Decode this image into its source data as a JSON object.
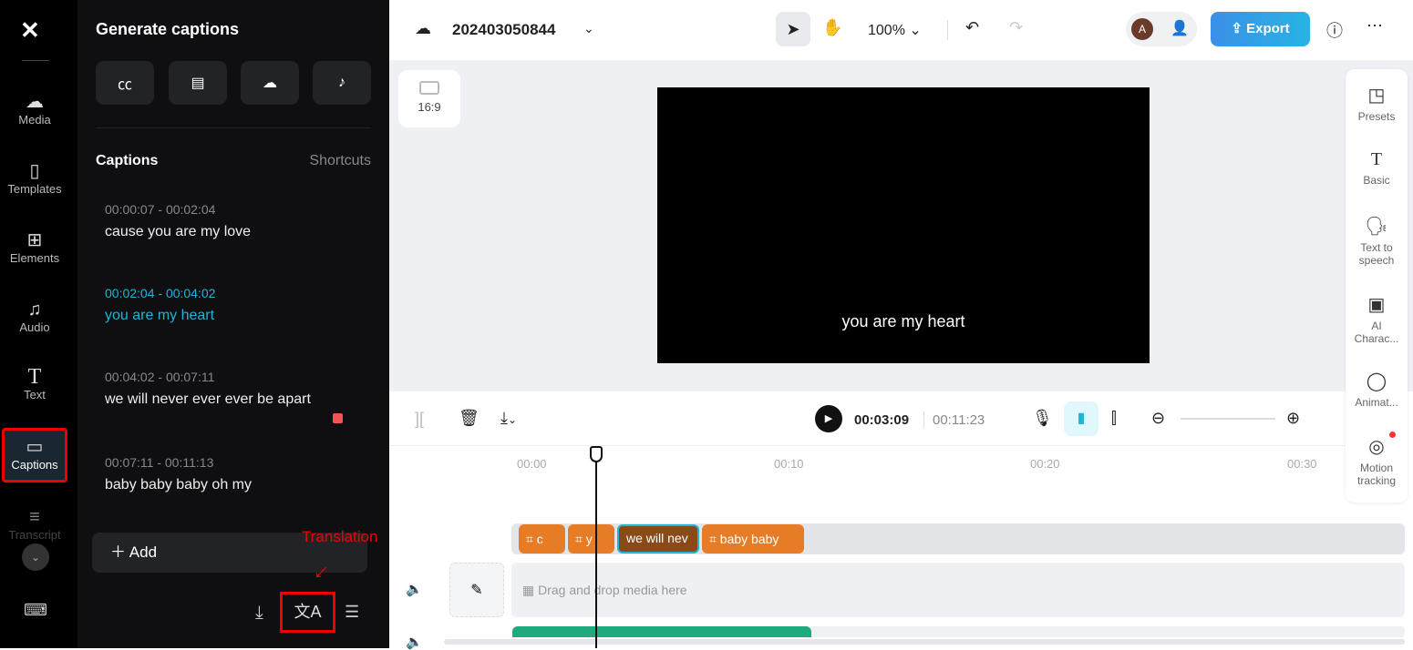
{
  "rail": {
    "items": [
      {
        "label": "Media",
        "icon": "cloud-upload-icon"
      },
      {
        "label": "Templates",
        "icon": "templates-icon"
      },
      {
        "label": "Elements",
        "icon": "elements-icon"
      },
      {
        "label": "Audio",
        "icon": "music-icon"
      },
      {
        "label": "Text",
        "icon": "text-icon"
      },
      {
        "label": "Captions",
        "icon": "captions-icon",
        "active": true
      },
      {
        "label": "Transcript",
        "icon": "transcript-icon"
      }
    ]
  },
  "panel": {
    "title": "Generate captions",
    "section": "Captions",
    "shortcuts": "Shortcuts",
    "add": "Add",
    "captions": [
      {
        "time": "00:00:07 - 00:02:04",
        "text": "cause you are my love"
      },
      {
        "time": "00:02:04 - 00:04:02",
        "text": "you are my heart",
        "active": true
      },
      {
        "time": "00:04:02 - 00:07:11",
        "text": "we will never ever ever be apart"
      },
      {
        "time": "00:07:11 - 00:11:13",
        "text": "baby baby baby oh my"
      }
    ],
    "annotation": "Translation"
  },
  "header": {
    "project": "202403050844",
    "zoom": "100%",
    "avatar": "A",
    "export": "Export"
  },
  "canvas": {
    "ratio": "16:9",
    "subtitle": "you are my heart"
  },
  "right_panel": [
    {
      "label": "Presets"
    },
    {
      "label": "Basic"
    },
    {
      "label": "Text to speech"
    },
    {
      "label": "AI Charac..."
    },
    {
      "label": "Animat..."
    },
    {
      "label": "Motion tracking"
    }
  ],
  "timeline": {
    "current": "00:03:09",
    "total": "00:11:23",
    "ticks": [
      "00:00",
      "00:10",
      "00:20",
      "00:30"
    ],
    "clips": [
      "c",
      "y",
      "we will nev",
      "baby baby"
    ],
    "drop": "Drag and drop media here"
  },
  "colors": {
    "accent": "#1fb5d6",
    "clip": "#e77c27",
    "export": "#3b8fe8",
    "annotation": "#e00000"
  }
}
